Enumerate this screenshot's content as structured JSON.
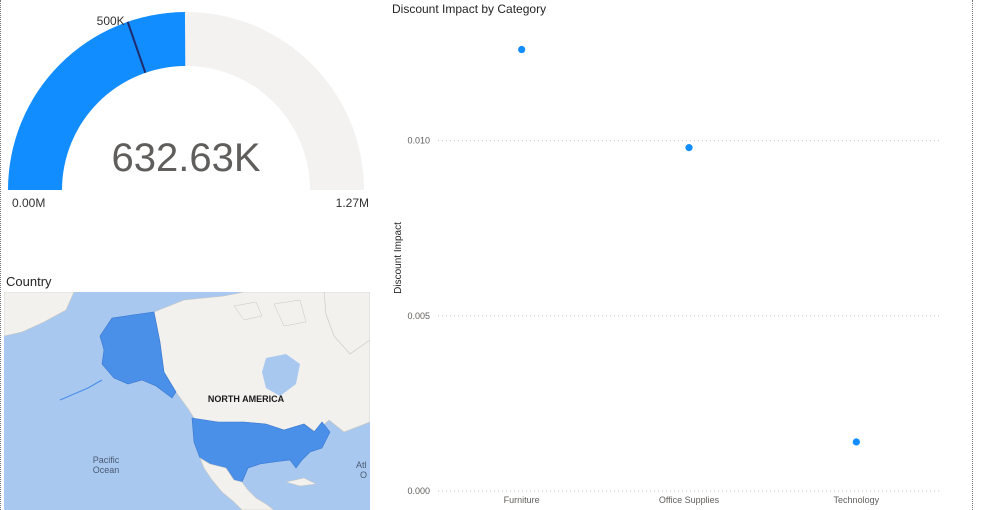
{
  "gauge": {
    "value_label": "632.63K",
    "min_label": "0.00M",
    "max_label": "1.27M",
    "target_label": "500K",
    "value": 632630,
    "min": 0,
    "max": 1270000,
    "target": 500000,
    "fill_color": "#118dff",
    "track_color": "#f3f2f1",
    "target_color": "#1f2a6e"
  },
  "map": {
    "title": "Country",
    "region_label": "NORTH AMERICA",
    "ocean_label_1": "Pacific",
    "ocean_label_2": "Ocean",
    "atlantic_fragment_1": "Atl",
    "atlantic_fragment_2": "O",
    "highlight_color": "#4a8fe8",
    "land_color": "#f2f1ee",
    "water_color": "#a9c8f0"
  },
  "chart_data": {
    "type": "scatter",
    "title": "Discount Impact by Category",
    "xlabel": "",
    "ylabel": "Discount Impact",
    "categories": [
      "Furniture",
      "Office Supplies",
      "Technology"
    ],
    "values": [
      0.0126,
      0.0098,
      0.0014
    ],
    "ylim": [
      0,
      0.0133
    ],
    "yticks": [
      0.0,
      0.005,
      0.01
    ],
    "ytick_labels": [
      "0.000",
      "0.005",
      "0.010"
    ],
    "grid": true,
    "point_color": "#118dff"
  }
}
